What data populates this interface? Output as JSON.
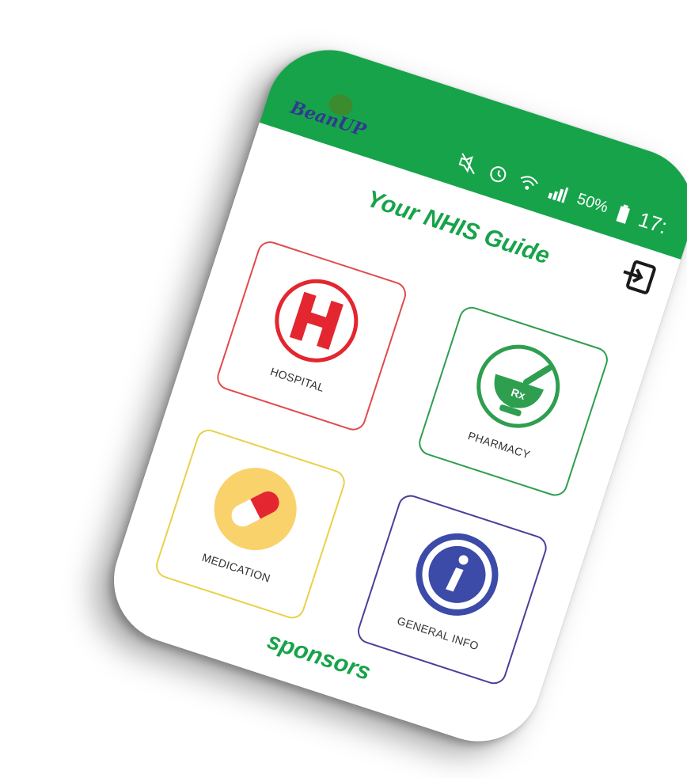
{
  "app": {
    "logo_text_a": "Bean",
    "logo_text_b": "UP"
  },
  "statusbar": {
    "battery_percent": "50%",
    "time": "17:",
    "icons": [
      "mute-icon",
      "alarm-icon",
      "wifi-icon",
      "signal-icon",
      "battery-icon"
    ]
  },
  "header": {
    "title": "Your NHIS Guide",
    "logout_icon": "logout-icon"
  },
  "tiles": [
    {
      "label": "HOSPITAL",
      "icon": "hospital-icon",
      "color": "#e04b4b"
    },
    {
      "label": "PHARMACY",
      "icon": "pharmacy-icon",
      "color": "#2e9e4f"
    },
    {
      "label": "MEDICATION",
      "icon": "medication-icon",
      "color": "#e8d14a"
    },
    {
      "label": "GENERAL INFO",
      "icon": "info-icon",
      "color": "#4a3f9a"
    }
  ],
  "footer": {
    "sponsors_label": "sponsors"
  },
  "colors": {
    "brand_green": "#17a34a",
    "logo_blue": "#2f3a8f"
  }
}
